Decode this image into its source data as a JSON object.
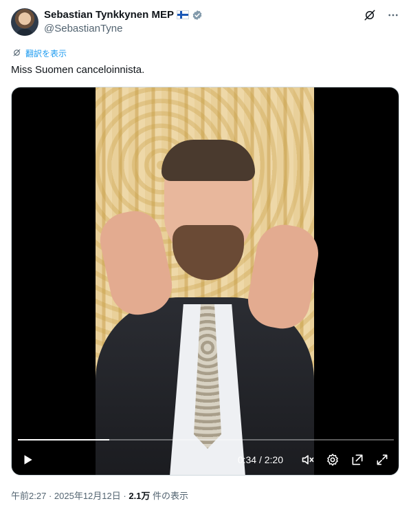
{
  "author": {
    "display_name": "Sebastian Tynkkynen MEP",
    "handle": "@SebastianTyne",
    "flag_icon": "finland-flag-icon",
    "verified_icon": "verified-badge-icon",
    "verified_color": "#829aab"
  },
  "actions": {
    "grok_icon": "grok-icon",
    "more_icon": "more-dots-icon"
  },
  "translate": {
    "label": "翻訳を表示",
    "icon": "translate-icon",
    "color": "#1d9bf0"
  },
  "tweet": {
    "text": "Miss Suomen canceloinnista."
  },
  "video": {
    "current_time": "0:34",
    "separator": "/",
    "duration": "2:20",
    "progress": 0.2428,
    "controls": {
      "play_icon": "play-icon",
      "mute_icon": "volume-muted-icon",
      "settings_icon": "settings-gear-icon",
      "popout_icon": "popout-icon",
      "fullscreen_icon": "fullscreen-icon"
    }
  },
  "meta": {
    "time": "午前2:27",
    "dot1": "·",
    "date": "2025年12月12日",
    "dot2": "·",
    "views_count": "2.1万",
    "views_label": "件の表示"
  },
  "colors": {
    "text_primary": "#0f1419",
    "text_secondary": "#536471",
    "link": "#1d9bf0"
  }
}
